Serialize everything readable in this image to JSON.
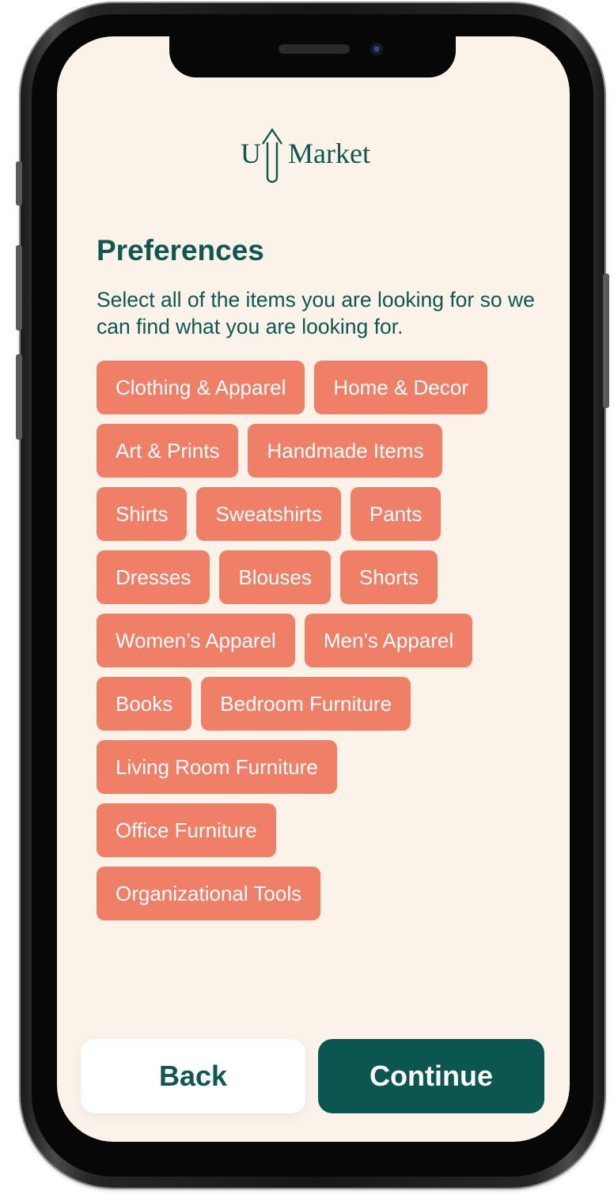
{
  "app": {
    "logo_text": "UpMarket",
    "brand_color": "#0f5751",
    "chip_color": "#f07f68",
    "background": "#fbf2e9"
  },
  "page": {
    "title": "Preferences",
    "subtitle": "Select all of the items you are looking for so we can find what you are looking for."
  },
  "chips": [
    [
      "Clothing & Apparel",
      "Home & Decor"
    ],
    [
      "Art & Prints",
      "Handmade Items"
    ],
    [
      "Shirts",
      "Sweatshirts",
      "Pants"
    ],
    [
      "Dresses",
      "Blouses",
      "Shorts"
    ],
    [
      "Women’s Apparel",
      "Men’s Apparel"
    ],
    [
      "Books",
      "Bedroom Furniture"
    ],
    [
      "Living Room Furniture"
    ],
    [
      "Office Furniture"
    ],
    [
      "Organizational Tools"
    ]
  ],
  "actions": {
    "back_label": "Back",
    "continue_label": "Continue"
  }
}
